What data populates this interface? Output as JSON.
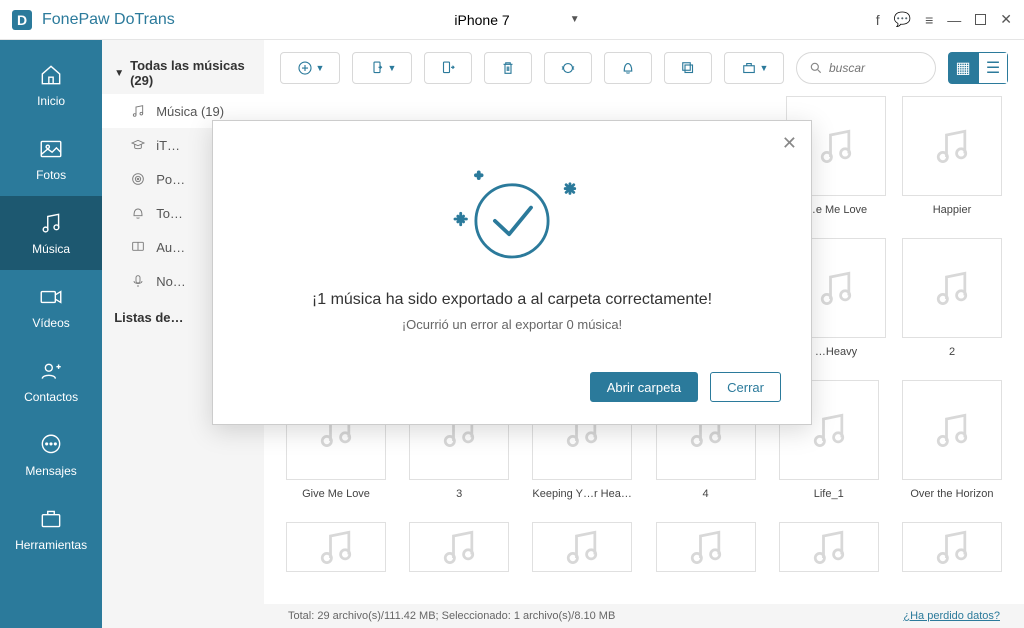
{
  "app": {
    "title": "FonePaw DoTrans"
  },
  "device": {
    "name": "iPhone 7"
  },
  "sidebar": {
    "items": [
      {
        "label": "Inicio"
      },
      {
        "label": "Fotos"
      },
      {
        "label": "Música"
      },
      {
        "label": "Vídeos"
      },
      {
        "label": "Contactos"
      },
      {
        "label": "Mensajes"
      },
      {
        "label": "Herramientas"
      }
    ]
  },
  "panel": {
    "heading": "Todas las músicas (29)",
    "items": [
      {
        "label": "Música (19)"
      },
      {
        "label": "iT…"
      },
      {
        "label": "Po…"
      },
      {
        "label": "To…"
      },
      {
        "label": "Au…"
      },
      {
        "label": "No…"
      }
    ],
    "playlists_heading": "Listas de…"
  },
  "search": {
    "placeholder": "buscar"
  },
  "tiles": {
    "row1": [
      {
        "label": "…e Me Love"
      },
      {
        "label": "Happier"
      }
    ],
    "row2": [
      {
        "label": "…Heavy"
      },
      {
        "label": "2"
      }
    ],
    "row3": [
      {
        "label": "Give Me Love"
      },
      {
        "label": "3"
      },
      {
        "label": "Keeping Y…r Head Up"
      },
      {
        "label": "4"
      },
      {
        "label": "Life_1"
      },
      {
        "label": "Over the Horizon"
      }
    ]
  },
  "status": {
    "text": "Total: 29 archivo(s)/111.42 MB; Seleccionado: 1 archivo(s)/8.10 MB",
    "link": "¿Ha perdido datos?"
  },
  "modal": {
    "title": "¡1 música ha sido exportado a al carpeta correctamente!",
    "subtitle": "¡Ocurrió un error al exportar 0 música!",
    "open": "Abrir carpeta",
    "close": "Cerrar"
  }
}
